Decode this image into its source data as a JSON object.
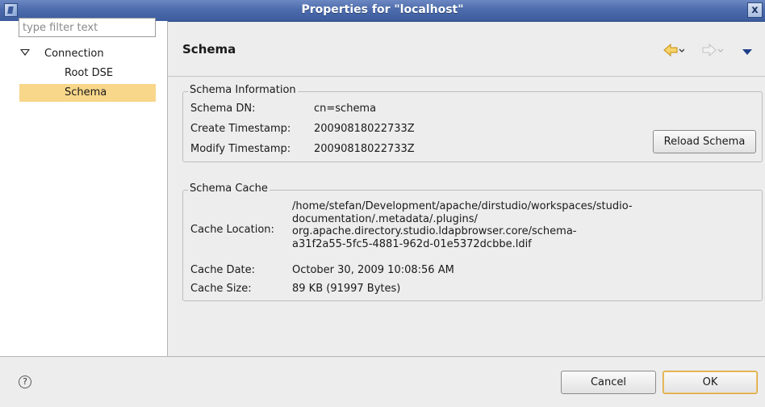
{
  "window": {
    "title": "Properties for \"localhost\"",
    "close_glyph": "x"
  },
  "sidebar": {
    "filter_placeholder": "type filter text",
    "items": [
      {
        "label": "Connection",
        "expanded": true
      },
      {
        "label": "Root DSE"
      },
      {
        "label": "Schema",
        "selected": true
      }
    ]
  },
  "page": {
    "title": "Schema",
    "nav_icons": [
      "back-arrow-icon",
      "forward-arrow-icon",
      "view-menu-icon"
    ]
  },
  "schema_info": {
    "legend": "Schema Information",
    "dn_label": "Schema DN:",
    "dn_value": "cn=schema",
    "create_label": "Create Timestamp:",
    "create_value": "20090818022733Z",
    "modify_label": "Modify Timestamp:",
    "modify_value": "20090818022733Z",
    "reload_button": "Reload Schema"
  },
  "schema_cache": {
    "legend": "Schema Cache",
    "location_label": "Cache Location:",
    "location_lines": [
      "/home/stefan/Development/apache/dirstudio/workspaces/studio-",
      "documentation/.metadata/.plugins/",
      "org.apache.directory.studio.ldapbrowser.core/schema-",
      "a31f2a55-5fc5-4881-962d-01e5372dcbbe.ldif"
    ],
    "date_label": "Cache Date:",
    "date_value": "October 30, 2009 10:08:56 AM",
    "size_label": "Cache Size:",
    "size_value": "89 KB (91997 Bytes)"
  },
  "footer": {
    "help_glyph": "?",
    "cancel_button": "Cancel",
    "ok_button": "OK"
  },
  "colors": {
    "titlebar": "#4d6cad",
    "selection": "#f8d68a",
    "nav_arrow": "#e8b830",
    "menu_arrow": "#1f3f8a"
  }
}
